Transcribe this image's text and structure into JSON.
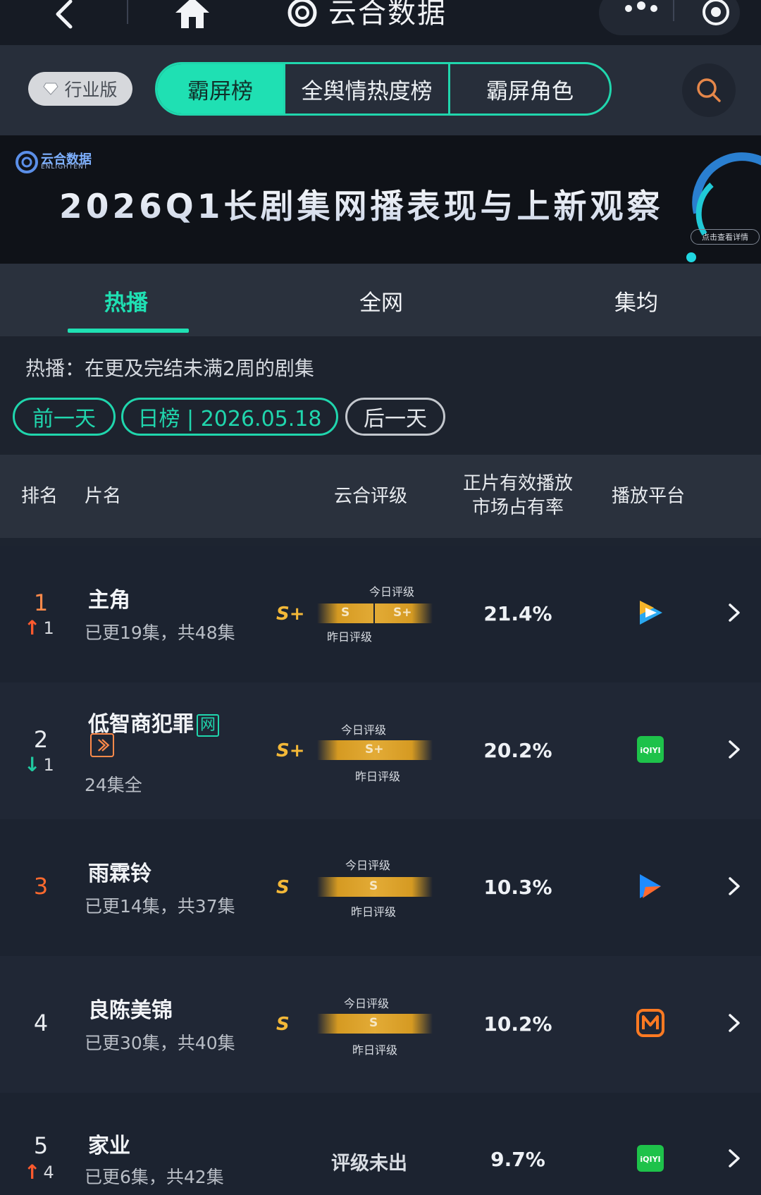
{
  "app": {
    "title": "云合数据"
  },
  "header": {
    "industry_badge": "行业版",
    "segments": [
      "霸屏榜",
      "全舆情热度榜",
      "霸屏角色"
    ]
  },
  "banner": {
    "title": "2026Q1长剧集网播表现与上新观察",
    "logo_text": "云合数据",
    "logo_sub": "ENLIGHTENT",
    "cta": "点击查看详情"
  },
  "subtabs": [
    "热播",
    "全网",
    "集均"
  ],
  "info": {
    "description": "热播：在更及完结未满2周的剧集",
    "prev_day": "前一天",
    "date_label": "日榜 | 2026.05.18",
    "next_day": "后一天"
  },
  "table": {
    "headers": {
      "rank": "排名",
      "name": "片名",
      "grade": "云合评级",
      "share_line1": "正片有效播放",
      "share_line2": "市场占有率",
      "platform": "播放平台"
    },
    "today_grade_label": "今日评级",
    "yesterday_grade_label": "昨日评级",
    "rows": [
      {
        "rank": "1",
        "trend": "1",
        "trend_dir": "up",
        "title": "主角",
        "episodes": "已更19集，共48集",
        "grade": "S+",
        "bar_left": "S",
        "bar_right": "S+",
        "share": "21.4%",
        "platform": "tencent-video"
      },
      {
        "rank": "2",
        "trend": "1",
        "trend_dir": "down",
        "title": "低智商犯罪",
        "title_tag": "网",
        "episodes": "24集全",
        "grade": "S+",
        "bar_center": "S+",
        "share": "20.2%",
        "platform": "iqiyi"
      },
      {
        "rank": "3",
        "title": "雨霖铃",
        "episodes": "已更14集，共37集",
        "grade": "S",
        "bar_center": "S",
        "share": "10.3%",
        "platform": "youku"
      },
      {
        "rank": "4",
        "title": "良陈美锦",
        "episodes": "已更30集，共40集",
        "grade": "S",
        "bar_center": "S",
        "share": "10.2%",
        "platform": "mango-tv"
      },
      {
        "rank": "5",
        "trend": "4",
        "trend_dir": "up",
        "title": "家业",
        "episodes": "已更6集，共42集",
        "grade_pending": "评级未出",
        "share": "9.7%",
        "platform": "iqiyi"
      }
    ]
  },
  "colors": {
    "accent": "#1fe0b3",
    "gold": "#e3ab36",
    "up": "#ff5a2e",
    "down": "#20c9a0"
  }
}
